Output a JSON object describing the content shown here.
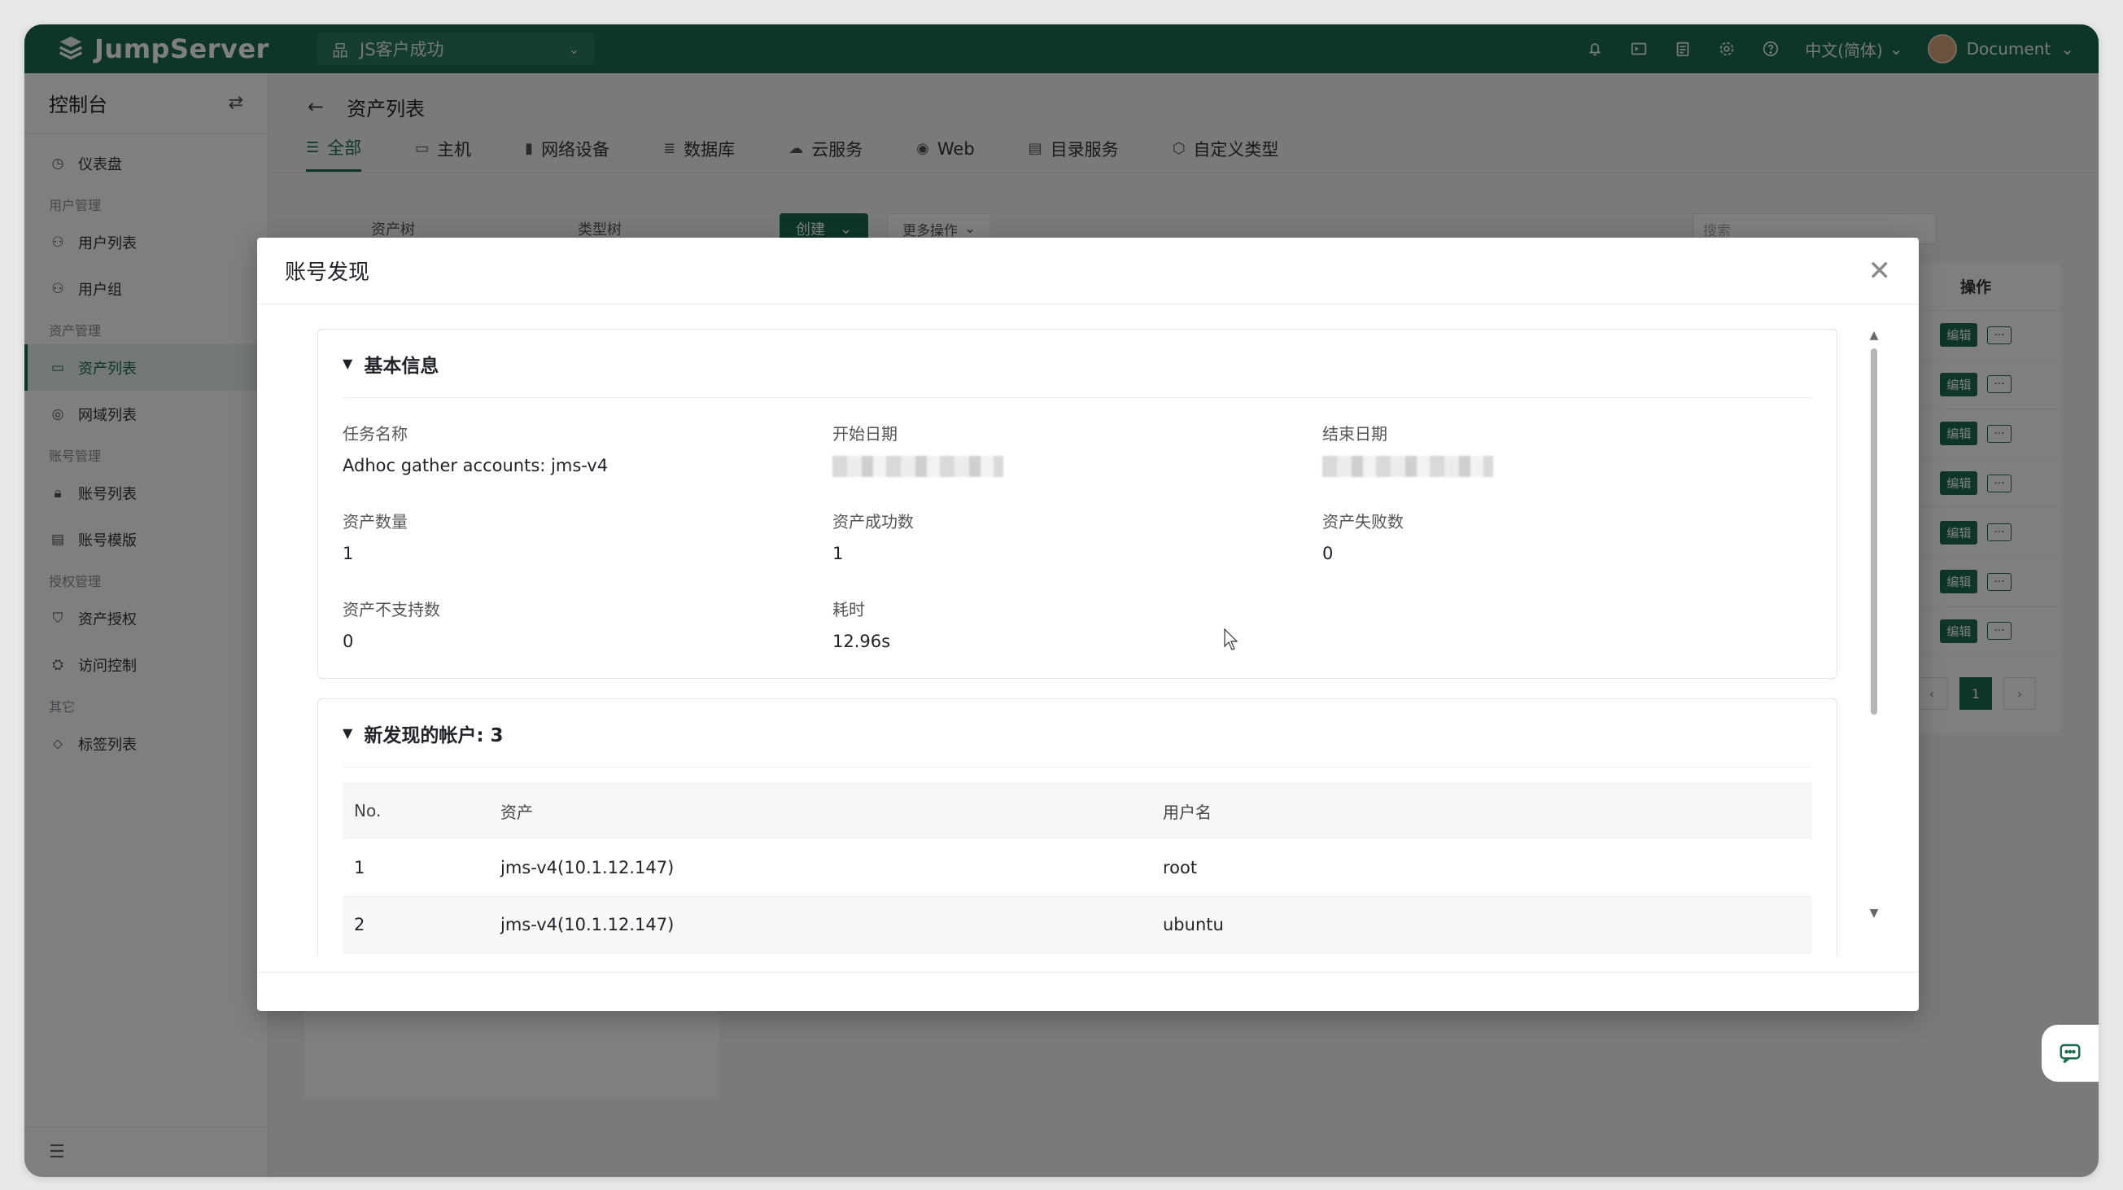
{
  "topbar": {
    "logo_text": "JumpServer",
    "org": "JS客户成功",
    "language": "中文(简体)",
    "user": "Document",
    "icons": [
      "bell-icon",
      "terminal-icon",
      "clipboard-icon",
      "gear-icon",
      "help-icon"
    ]
  },
  "sidebar": {
    "title": "控制台",
    "dashboard": "仪表盘",
    "groups": {
      "user_mgmt": "用户管理",
      "asset_mgmt": "资产管理",
      "account_mgmt": "账号管理",
      "perm_mgmt": "授权管理",
      "other": "其它"
    },
    "items": {
      "user_list": "用户列表",
      "user_group": "用户组",
      "asset_list": "资产列表",
      "zone_list": "网域列表",
      "account_list": "账号列表",
      "account_template": "账号模版",
      "asset_perm": "资产授权",
      "access_control": "访问控制",
      "label_list": "标签列表"
    }
  },
  "page": {
    "title": "资产列表",
    "tabs": [
      "全部",
      "主机",
      "网络设备",
      "数据库",
      "云服务",
      "Web",
      "目录服务",
      "自定义类型"
    ],
    "create_label": "创建",
    "more_label": "更多操作",
    "search_placeholder": "搜索",
    "tree_label": "资产树",
    "type_tree_label": "类型树",
    "op_header": "操作",
    "edit_label": "编辑",
    "more_dots": "···",
    "current_page": "1"
  },
  "modal": {
    "title": "账号发现",
    "basic_section": "基本信息",
    "fields": {
      "task_name_label": "任务名称",
      "task_name": "Adhoc gather accounts: jms-v4",
      "start_date_label": "开始日期",
      "end_date_label": "结束日期",
      "asset_count_label": "资产数量",
      "asset_count": "1",
      "asset_success_label": "资产成功数",
      "asset_success": "1",
      "asset_fail_label": "资产失败数",
      "asset_fail": "0",
      "asset_unsupported_label": "资产不支持数",
      "asset_unsupported": "0",
      "duration_label": "耗时",
      "duration": "12.96s"
    },
    "accounts_section": "新发现的帐户: 3",
    "table": {
      "headers": [
        "No.",
        "资产",
        "用户名"
      ],
      "rows": [
        {
          "no": "1",
          "asset": "jms-v4(10.1.12.147)",
          "username": "root"
        },
        {
          "no": "2",
          "asset": "jms-v4(10.1.12.147)",
          "username": "ubuntu"
        }
      ]
    }
  }
}
